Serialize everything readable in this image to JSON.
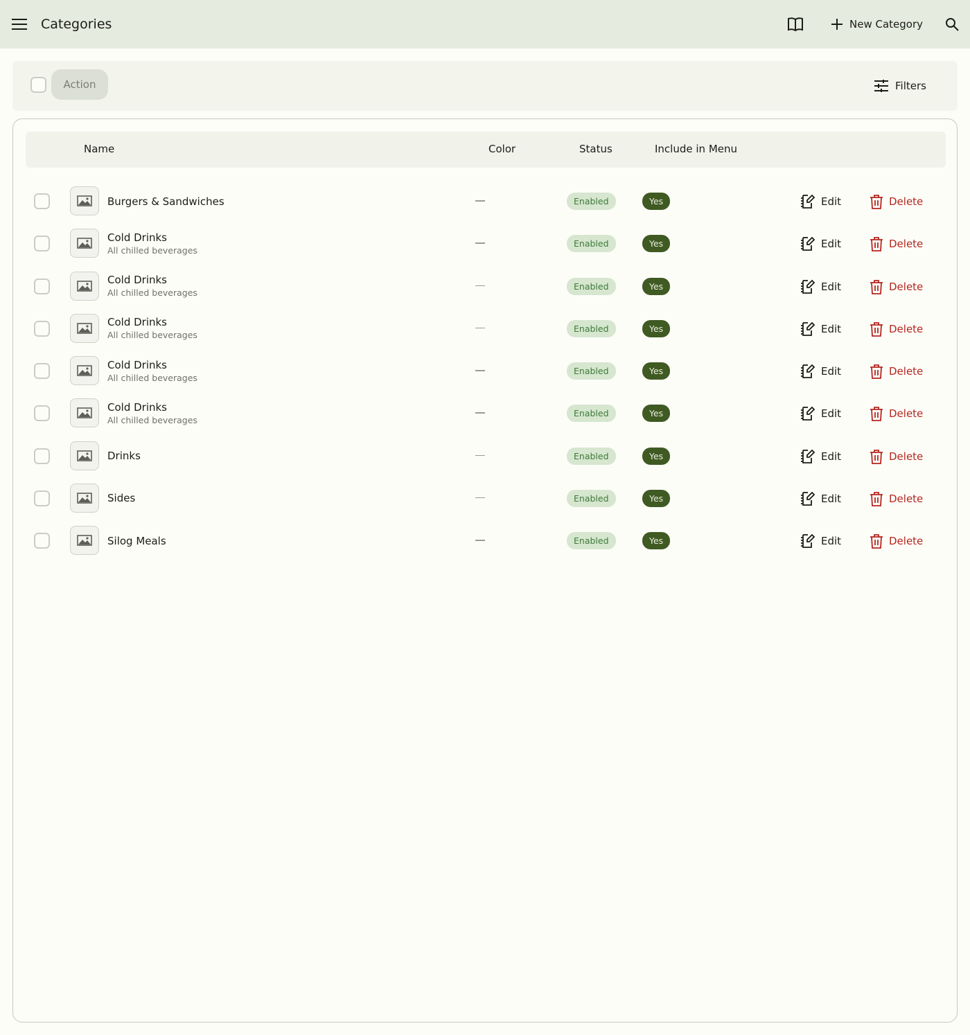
{
  "appbar": {
    "title": "Categories",
    "new_category_label": "New Category"
  },
  "toolbar": {
    "action_label": "Action",
    "filters_label": "Filters"
  },
  "table": {
    "columns": [
      "Name",
      "Color",
      "Status",
      "Include in Menu"
    ],
    "rows": [
      {
        "name": "Burgers & Sandwiches",
        "description": "",
        "color": "—",
        "status": "Enabled",
        "include_in_menu": "Yes"
      },
      {
        "name": "Cold Drinks",
        "description": "All chilled beverages",
        "color": "—",
        "status": "Enabled",
        "include_in_menu": "Yes"
      },
      {
        "name": "Cold Drinks",
        "description": "All chilled beverages",
        "color": "—",
        "status": "Enabled",
        "include_in_menu": "Yes"
      },
      {
        "name": "Cold Drinks",
        "description": "All chilled beverages",
        "color": "—",
        "status": "Enabled",
        "include_in_menu": "Yes"
      },
      {
        "name": "Cold Drinks",
        "description": "All chilled beverages",
        "color": "—",
        "status": "Enabled",
        "include_in_menu": "Yes"
      },
      {
        "name": "Cold Drinks",
        "description": "All chilled beverages",
        "color": "—",
        "status": "Enabled",
        "include_in_menu": "Yes"
      },
      {
        "name": "Drinks",
        "description": "",
        "color": "—",
        "status": "Enabled",
        "include_in_menu": "Yes"
      },
      {
        "name": "Sides",
        "description": "",
        "color": "—",
        "status": "Enabled",
        "include_in_menu": "Yes"
      },
      {
        "name": "Silog Meals",
        "description": "",
        "color": "—",
        "status": "Enabled",
        "include_in_menu": "Yes"
      }
    ],
    "edit_label": "Edit",
    "delete_label": "Delete"
  },
  "colors": {
    "appbar_bg": "#e6ebdf",
    "status_bg": "#d6e6cf",
    "status_text": "#3e7a3a",
    "yes_bg": "#3f5a22",
    "delete_text": "#b3261e"
  },
  "icons": {
    "menu": "hamburger-menu-icon",
    "book": "book-open-icon",
    "add": "plus-icon",
    "search": "search-icon",
    "filters": "tune-sliders-icon",
    "thumb": "image-placeholder-icon",
    "edit": "edit-note-icon",
    "delete": "trash-icon"
  }
}
